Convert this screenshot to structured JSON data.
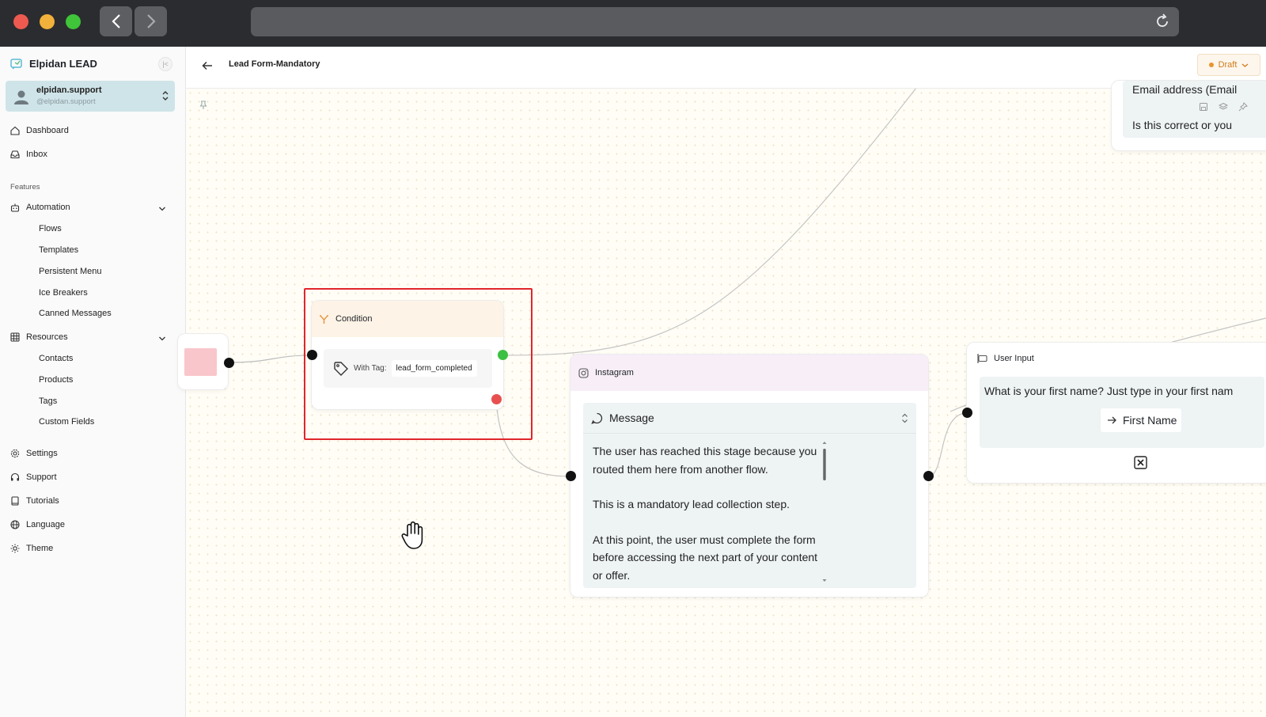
{
  "app": {
    "name": "Elpidan LEAD"
  },
  "user": {
    "name": "elpidan.support",
    "handle": "@elpidan.support"
  },
  "sidebar": {
    "main": [
      {
        "label": "Dashboard",
        "icon": "home-icon"
      },
      {
        "label": "Inbox",
        "icon": "inbox-icon"
      }
    ],
    "features_heading": "Features",
    "automation": {
      "label": "Automation",
      "items": [
        "Flows",
        "Templates",
        "Persistent Menu",
        "Ice Breakers",
        "Canned Messages"
      ]
    },
    "resources": {
      "label": "Resources",
      "items": [
        "Contacts",
        "Products",
        "Tags",
        "Custom Fields"
      ]
    },
    "bottom": [
      {
        "label": "Settings",
        "icon": "gear-icon"
      },
      {
        "label": "Support",
        "icon": "headset-icon"
      },
      {
        "label": "Tutorials",
        "icon": "book-icon"
      },
      {
        "label": "Language",
        "icon": "globe-icon"
      },
      {
        "label": "Theme",
        "icon": "sun-icon"
      }
    ]
  },
  "header": {
    "title": "Lead Form-Mandatory",
    "status": "Draft"
  },
  "nodes": {
    "condition": {
      "title": "Condition",
      "tag_label": "With Tag:",
      "tag_value": "lead_form_completed"
    },
    "instagram": {
      "title": "Instagram",
      "message_label": "Message",
      "paragraphs": [
        "The user has reached this stage because you routed them here from another flow.",
        "This is a mandatory lead collection step.",
        "At this point, the user must complete the form before accessing the next part of your content or offer."
      ]
    },
    "user_input": {
      "title": "User Input",
      "question": "What is your first name? Just type in your first nam",
      "field": "First Name"
    },
    "top": {
      "line1": "Email address (Email",
      "line2": "Is this correct or you"
    }
  },
  "colors": {
    "accent": "#e0252b",
    "success_port": "#3cc043",
    "fail_port": "#e8504f",
    "draft": "#d07c1c"
  }
}
